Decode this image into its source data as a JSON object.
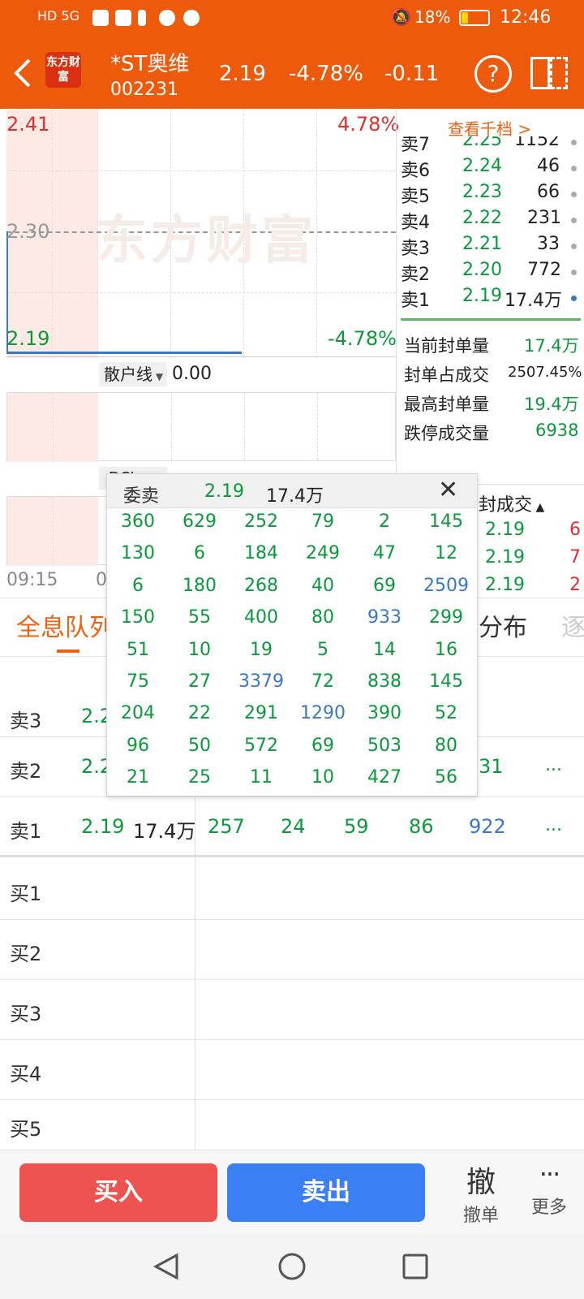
{
  "status_bar": {
    "carrier": "HD 5G",
    "battery": "18%",
    "time": "12:46"
  },
  "header": {
    "logo_text": "东方财富",
    "stock_name": "*ST奥维",
    "stock_code": "002231",
    "price": "2.19",
    "change_pct": "-4.78%",
    "change": "-0.11",
    "help_label": "?"
  },
  "chart": {
    "top_price": "2.41",
    "top_pct": "4.78%",
    "mid_price": "2.30",
    "bottom_price": "2.19",
    "bottom_pct": "-4.78%",
    "watermark": "东方财富",
    "indicator_select": "散户线",
    "indicator_value": "0.00",
    "indicator2_select": "DCL...",
    "time_start": "09:15",
    "time_start2": "0"
  },
  "order_book": {
    "view_more": "查看千档 >",
    "sells": [
      {
        "label": "卖7",
        "price": "2.25",
        "vol": "1152"
      },
      {
        "label": "卖6",
        "price": "2.24",
        "vol": "46"
      },
      {
        "label": "卖5",
        "price": "2.23",
        "vol": "66"
      },
      {
        "label": "卖4",
        "price": "2.22",
        "vol": "231"
      },
      {
        "label": "卖3",
        "price": "2.21",
        "vol": "33"
      },
      {
        "label": "卖2",
        "price": "2.20",
        "vol": "772"
      },
      {
        "label": "卖1",
        "price": "2.19",
        "vol": "17.4万"
      }
    ],
    "stats": [
      {
        "label": "当前封单量",
        "value": "17.4万"
      },
      {
        "label": "封单占成交",
        "value": "2507.45%"
      },
      {
        "label": "最高封单量",
        "value": "19.4万"
      },
      {
        "label": "跌停成交量",
        "value": "6938"
      }
    ],
    "trades_header": "封成交",
    "trades": [
      {
        "price": "2.19",
        "vol": "6"
      },
      {
        "price": "2.19",
        "vol": "7"
      },
      {
        "price": "2.19",
        "vol": "2"
      }
    ]
  },
  "tabs": {
    "left": "全息队列",
    "right": "分布",
    "far_right": "逐"
  },
  "queue": {
    "rows": [
      {
        "label": "卖3",
        "price": "2.2"
      },
      {
        "label": "卖2",
        "price": "2.2",
        "tail": "31",
        "more": "..."
      },
      {
        "label": "卖1",
        "price": "2.19",
        "vol": "17.4万",
        "cells": [
          "257",
          "24",
          "59",
          "86",
          "922"
        ],
        "more": "..."
      },
      {
        "label": "买1"
      },
      {
        "label": "买2"
      },
      {
        "label": "买3"
      },
      {
        "label": "买4"
      },
      {
        "label": "买5"
      }
    ]
  },
  "popup": {
    "title": "委卖",
    "price": "2.19",
    "vol": "17.4万",
    "close_label": "✕",
    "grid": [
      [
        "360",
        "629",
        "252",
        "79",
        "2",
        "145"
      ],
      [
        "130",
        "6",
        "184",
        "249",
        "47",
        "12"
      ],
      [
        "6",
        "180",
        "268",
        "40",
        "69",
        "2509"
      ],
      [
        "150",
        "55",
        "400",
        "80",
        "933",
        "299"
      ],
      [
        "51",
        "10",
        "19",
        "5",
        "14",
        "16"
      ],
      [
        "75",
        "27",
        "3379",
        "72",
        "838",
        "145"
      ],
      [
        "204",
        "22",
        "291",
        "1290",
        "390",
        "52"
      ],
      [
        "96",
        "50",
        "572",
        "69",
        "503",
        "80"
      ],
      [
        "21",
        "25",
        "11",
        "10",
        "427",
        "56"
      ]
    ]
  },
  "bottom_bar": {
    "buy_label": "买入",
    "sell_label": "卖出",
    "cancel_icon": "撤",
    "cancel_label": "撤单",
    "more_icon": "···",
    "more_label": "更多"
  }
}
